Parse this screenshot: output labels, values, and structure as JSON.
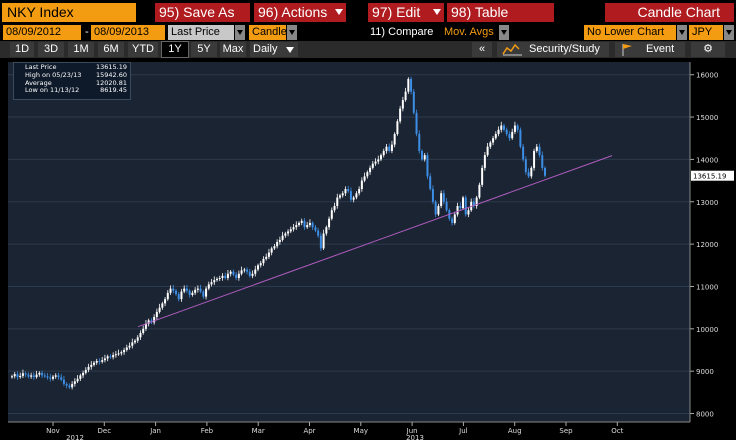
{
  "toolbar": {
    "ticker": "NKY Index",
    "buttons": [
      {
        "num": "95)",
        "label": "Save As"
      },
      {
        "num": "96)",
        "label": "Actions"
      },
      {
        "num": "97)",
        "label": "Edit"
      },
      {
        "num": "98)",
        "label": "Table"
      }
    ],
    "title": "Candle Chart"
  },
  "inputs": {
    "start_date": "08/09/2012",
    "dash": "-",
    "end_date": "08/09/2013",
    "price_field": "Last Price",
    "chart_style": "Candle",
    "compare_label": "11) Compare",
    "mov_avgs": "Mov. Avgs",
    "lower_chart": "No Lower Chart",
    "currency": "JPY"
  },
  "periods": [
    "1D",
    "3D",
    "1M",
    "6M",
    "YTD",
    "1Y",
    "5Y",
    "Max"
  ],
  "active_period": "1Y",
  "frequency": "Daily",
  "toolbar3": {
    "collapse": "«",
    "security_study": "Security/Study",
    "event": "Event"
  },
  "legend": {
    "rows": [
      {
        "label": "Last Price",
        "value": "13615.19"
      },
      {
        "label": "High on 05/23/13",
        "value": "15942.60"
      },
      {
        "label": "Average",
        "value": "12020.81"
      },
      {
        "label": "Low on 11/13/12",
        "value": "8619.45"
      }
    ]
  },
  "chart_data": {
    "type": "candlestick",
    "title": "",
    "ylim": [
      7800,
      16300
    ],
    "yticks": [
      8000,
      9000,
      10000,
      11000,
      12000,
      13000,
      14000,
      15000,
      16000
    ],
    "ytick_labels": [
      "8000",
      "9000",
      "10000",
      "11000",
      "12000",
      "13000",
      "14000",
      "15000",
      "16000"
    ],
    "x_month_labels": [
      "Nov",
      "Dec",
      "Jan",
      "Feb",
      "Mar",
      "Apr",
      "May",
      "Jun",
      "Jul",
      "Aug",
      "Sep",
      "Oct"
    ],
    "year_labels": [
      "2012",
      "2013"
    ],
    "last_price_label": "13615.19",
    "colors": {
      "up": "#ffffff",
      "down": "#3d8ee6",
      "trend": "#b05cc0",
      "background": "#1b2432",
      "axis_bg": "#000000"
    },
    "closes": [
      8880,
      8930,
      8860,
      8890,
      8950,
      8920,
      8870,
      8900,
      8860,
      8920,
      8960,
      8900,
      8880,
      8850,
      8820,
      8870,
      8900,
      8860,
      8800,
      8700,
      8660,
      8620,
      8700,
      8760,
      8820,
      8900,
      8960,
      9030,
      9100,
      9150,
      9200,
      9240,
      9220,
      9260,
      9300,
      9350,
      9330,
      9380,
      9400,
      9420,
      9450,
      9500,
      9560,
      9600,
      9680,
      9720,
      9800,
      9900,
      10000,
      10120,
      10200,
      10150,
      10280,
      10400,
      10500,
      10600,
      10700,
      10850,
      10950,
      10900,
      10820,
      10700,
      10880,
      10950,
      10900,
      10800,
      10850,
      10920,
      10950,
      10880,
      10760,
      10950,
      11050,
      11100,
      11150,
      11180,
      11200,
      11250,
      11200,
      11300,
      11350,
      11280,
      11200,
      11300,
      11380,
      11400,
      11350,
      11250,
      11300,
      11400,
      11500,
      11550,
      11650,
      11700,
      11800,
      11900,
      11950,
      12050,
      12100,
      12200,
      12250,
      12300,
      12350,
      12400,
      12450,
      12500,
      12550,
      12400,
      12450,
      12500,
      12400,
      12320,
      12200,
      11900,
      12250,
      12400,
      12600,
      12800,
      12900,
      13100,
      13150,
      13200,
      13300,
      13250,
      13050,
      13100,
      13200,
      13300,
      13500,
      13600,
      13700,
      13800,
      13900,
      13950,
      14000,
      14100,
      14200,
      14300,
      14200,
      14350,
      14600,
      14900,
      15200,
      15400,
      15600,
      15900,
      15600,
      15100,
      14600,
      14200,
      14000,
      14100,
      13600,
      13300,
      13000,
      12700,
      12900,
      13200,
      13000,
      12800,
      12600,
      12500,
      12700,
      12900,
      12850,
      13100,
      12700,
      12800,
      13000,
      12900,
      13100,
      13400,
      13800,
      14100,
      14300,
      14400,
      14500,
      14600,
      14700,
      14800,
      14700,
      14600,
      14500,
      14650,
      14800,
      14700,
      14300,
      14000,
      13700,
      13600,
      13800,
      14200,
      14300,
      14100,
      13800,
      13615
    ]
  }
}
